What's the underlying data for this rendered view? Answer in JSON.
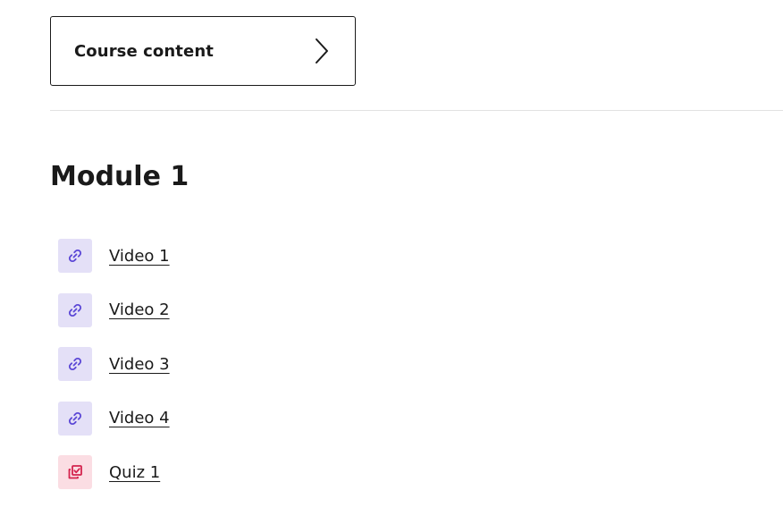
{
  "course_button": {
    "label": "Course content",
    "icon": "chevron-right-icon"
  },
  "module": {
    "title": "Module 1",
    "items": [
      {
        "label": "Video 1",
        "icon": "link-icon",
        "icon_bg": "#e4e0f7",
        "icon_color": "#5b47d6"
      },
      {
        "label": "Video 2",
        "icon": "link-icon",
        "icon_bg": "#e4e0f7",
        "icon_color": "#5b47d6"
      },
      {
        "label": "Video 3",
        "icon": "link-icon",
        "icon_bg": "#e4e0f7",
        "icon_color": "#5b47d6"
      },
      {
        "label": "Video 4",
        "icon": "link-icon",
        "icon_bg": "#e4e0f7",
        "icon_color": "#5b47d6"
      },
      {
        "label": "Quiz 1",
        "icon": "quiz-icon",
        "icon_bg": "#fbdde3",
        "icon_color": "#d4244e"
      }
    ]
  }
}
